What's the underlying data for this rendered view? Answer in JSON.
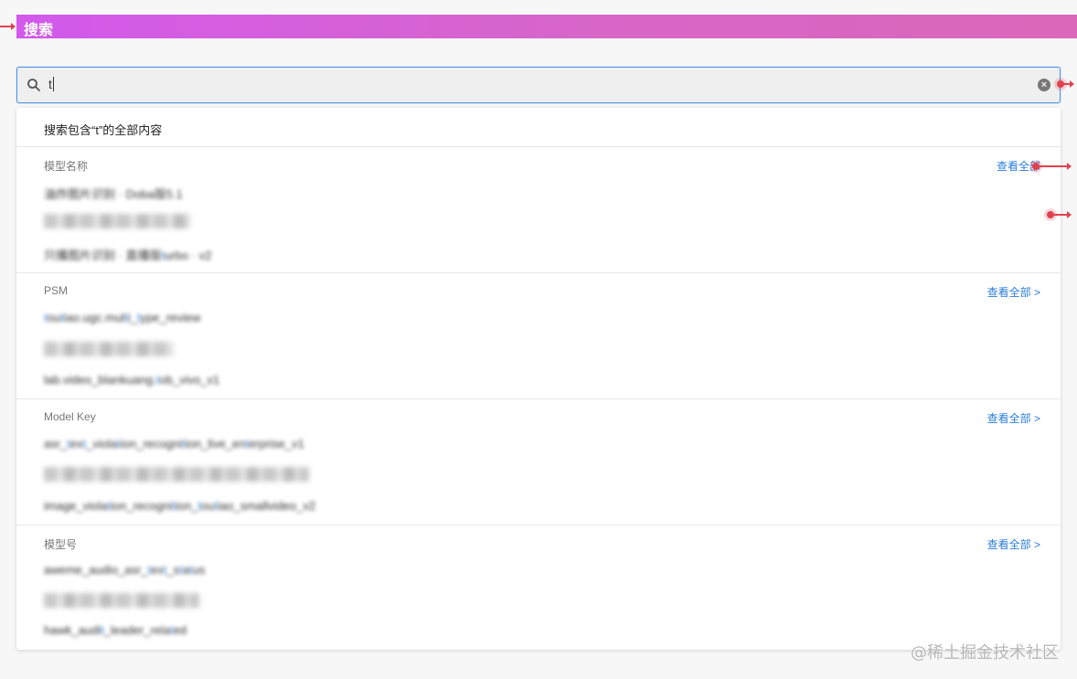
{
  "header": {
    "title": "搜索"
  },
  "search": {
    "value": "t",
    "placeholder": ""
  },
  "dropdown": {
    "search_all_label": "搜索包含“t”的全部内容",
    "sections": [
      {
        "title": "模型名称",
        "view_all": "查看全部",
        "items": [
          "油炸图片识别 · Doba版5.1",
          "",
          "只播图片识别 · 直播版turbo · v2"
        ]
      },
      {
        "title": "PSM",
        "view_all": "查看全部 >",
        "items": [
          "toutiao.ugc.multi_type_review",
          "",
          "lab.video_blankuang.tob_vivo_v1"
        ]
      },
      {
        "title": "Model Key",
        "view_all": "查看全部 >",
        "items": [
          "asr_text_violation_recognition_live_enterprise_v1",
          "",
          "image_violation_recognition_toutiao_smallvideo_v2"
        ]
      },
      {
        "title": "模型号",
        "view_all": "查看全部 >",
        "items": [
          "aweme_audio_asr_text_status",
          "",
          "hawk_audit_leader_related"
        ]
      }
    ]
  },
  "watermark": "@稀土掘金技术社区",
  "colors": {
    "accent": "#2a7ed8",
    "header_gradient_start": "#d259ec",
    "header_gradient_end": "#da67b9",
    "annotation": "#e0424f"
  }
}
